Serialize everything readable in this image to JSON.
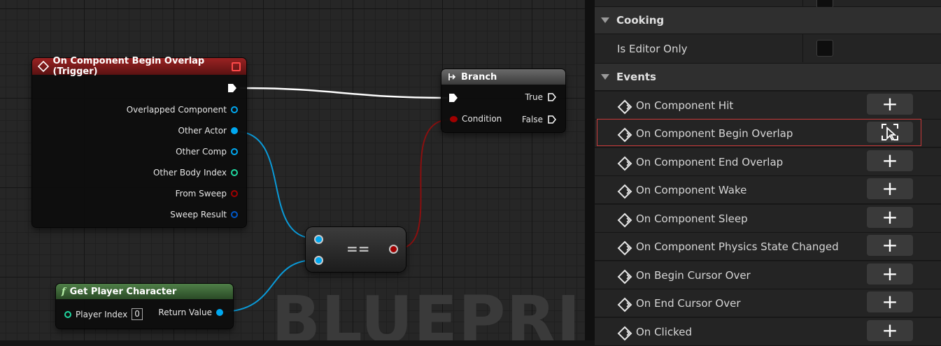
{
  "graph": {
    "watermark": "BLUEPRINT",
    "overlap_node": {
      "title": "On Component Begin Overlap (Trigger)",
      "pins": [
        "Overlapped Component",
        "Other Actor",
        "Other Comp",
        "Other Body Index",
        "From Sweep",
        "Sweep Result"
      ]
    },
    "branch_node": {
      "title": "Branch",
      "true_label": "True",
      "false_label": "False",
      "condition_label": "Condition"
    },
    "equal_node": {
      "label": "=="
    },
    "get_player_node": {
      "title": "Get Player Character",
      "function_icon": "f",
      "player_index_label": "Player Index",
      "player_index_value": "0",
      "return_value_label": "Return Value"
    }
  },
  "details": {
    "categories": {
      "cooking": "Cooking",
      "events": "Events"
    },
    "is_editor_only_label": "Is Editor Only",
    "events": [
      "On Component Hit",
      "On Component Begin Overlap",
      "On Component End Overlap",
      "On Component Wake",
      "On Component Sleep",
      "On Component Physics State Changed",
      "On Begin Cursor Over",
      "On End Cursor Over",
      "On Clicked"
    ],
    "add_symbol": "+"
  },
  "colors": {
    "event_header": "#8a1e1e",
    "function_header": "#3f6b3a",
    "branch_header": "#4a4a4a",
    "object_pin": "#00a8f0",
    "int_pin": "#20d8a0",
    "bool_pin": "#a00000",
    "struct_pin": "#0058c8",
    "highlight": "#c83a3a"
  }
}
